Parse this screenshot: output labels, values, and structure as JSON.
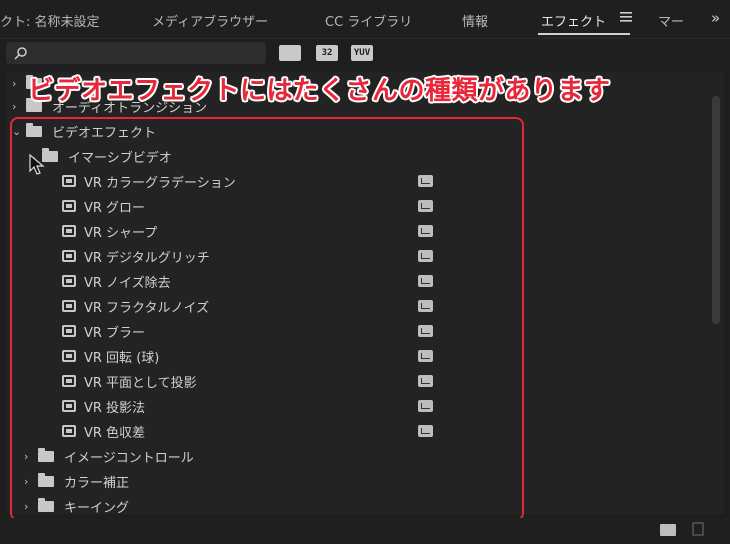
{
  "tabs": [
    {
      "label": "クト: 名称未設定"
    },
    {
      "label": "メディアブラウザー"
    },
    {
      "label": "CC ライブラリ"
    },
    {
      "label": "情報"
    },
    {
      "label": "エフェクト"
    },
    {
      "label": "マー"
    }
  ],
  "overflow_label": "»",
  "filters": {
    "accelerated": "",
    "bit32": "32",
    "yuv": "YUV"
  },
  "annotation": "ビデオエフェクトにはたくさんの種類があります",
  "tree": {
    "hidden_rows": [
      "",
      "オーディオトランジション"
    ],
    "video_effects": "ビデオエフェクト",
    "immersive": "イマーシブビデオ",
    "effects": [
      "VR カラーグラデーション",
      "VR グロー",
      "VR シャープ",
      "VR デジタルグリッチ",
      "VR ノイズ除去",
      "VR フラクタルノイズ",
      "VR ブラー",
      "VR 回転 (球)",
      "VR 平面として投影",
      "VR 投影法",
      "VR 色収差"
    ],
    "more_folders": [
      "イメージコントロール",
      "カラー補正",
      "キーイング"
    ]
  },
  "colors": {
    "annotation": "#e8283a",
    "background": "#1e1e1e"
  }
}
